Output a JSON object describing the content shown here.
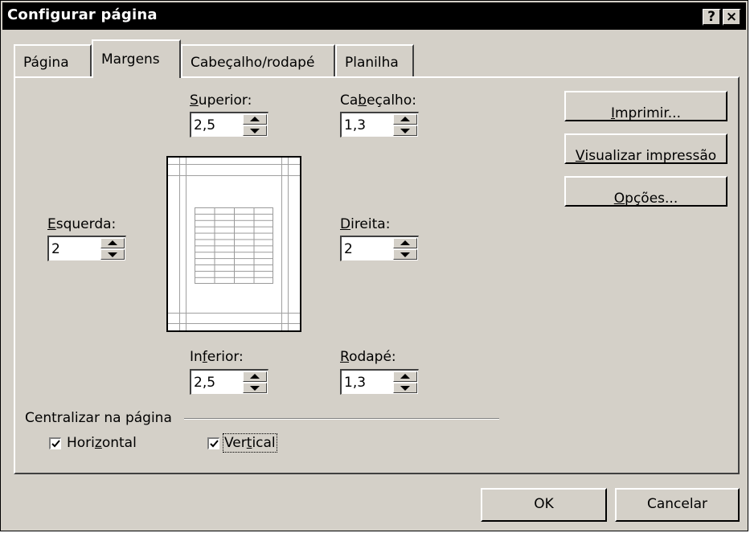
{
  "window": {
    "title": "Configurar página",
    "help_label": "?",
    "close_label": "×"
  },
  "tabs": [
    {
      "label": "Página"
    },
    {
      "label": "Margens",
      "selected": true
    },
    {
      "label": "Cabeçalho/rodapé"
    },
    {
      "label": "Planilha"
    }
  ],
  "margins": {
    "superior": {
      "label_u": "S",
      "label_rest": "uperior:",
      "value": "2,5"
    },
    "cabecalho": {
      "label_pre": "Ca",
      "label_u": "b",
      "label_rest": "eçalho:",
      "value": "1,3"
    },
    "esquerda": {
      "label_u": "E",
      "label_rest": "squerda:",
      "value": "2"
    },
    "direita": {
      "label_u": "D",
      "label_rest": "ireita:",
      "value": "2"
    },
    "inferior": {
      "label_pre": "In",
      "label_u": "f",
      "label_rest": "erior:",
      "value": "2,5"
    },
    "rodape": {
      "label_u": "R",
      "label_rest": "odapé:",
      "value": "1,3"
    }
  },
  "side_buttons": {
    "imprimir": {
      "u": "I",
      "rest": "mprimir..."
    },
    "visualizar": {
      "u": "V",
      "rest": "isualizar impressão"
    },
    "opcoes": {
      "u": "O",
      "rest": "pções..."
    }
  },
  "center": {
    "group_label": "Centralizar na página",
    "horizontal": {
      "pre": "Hori",
      "u": "z",
      "rest": "ontal",
      "checked": true
    },
    "vertical": {
      "pre": "Ver",
      "u": "t",
      "rest": "ical",
      "checked": true
    }
  },
  "footer": {
    "ok_label": "OK",
    "cancel_label": "Cancelar"
  }
}
